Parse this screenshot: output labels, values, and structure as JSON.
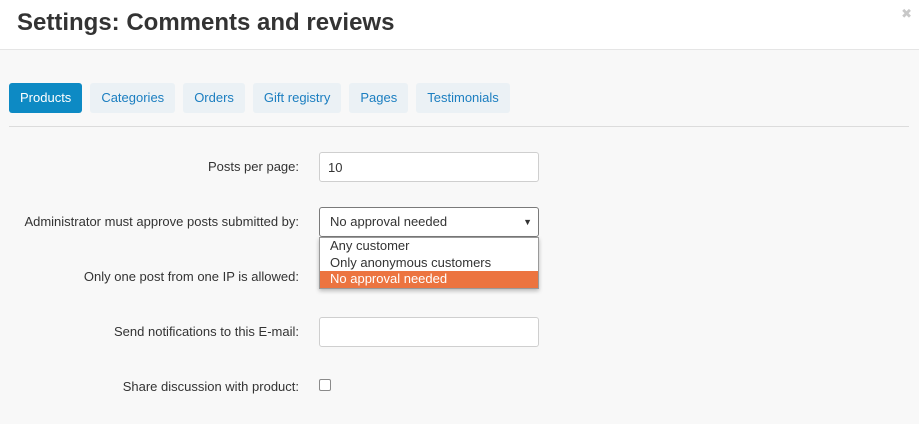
{
  "header": {
    "title": "Settings: Comments and reviews",
    "close_glyph": "✖",
    "close_icon": "close-icon"
  },
  "tabs": [
    {
      "label": "Products",
      "active": true
    },
    {
      "label": "Categories",
      "active": false
    },
    {
      "label": "Orders",
      "active": false
    },
    {
      "label": "Gift registry",
      "active": false
    },
    {
      "label": "Pages",
      "active": false
    },
    {
      "label": "Testimonials",
      "active": false
    }
  ],
  "form": {
    "posts_per_page": {
      "label": "Posts per page:",
      "value": "10"
    },
    "approve": {
      "label": "Administrator must approve posts submitted by:",
      "selected": "No approval needed",
      "options": [
        "Any customer",
        "Only anonymous customers",
        "No approval needed"
      ]
    },
    "one_post_ip": {
      "label": "Only one post from one IP is allowed:"
    },
    "notify_email": {
      "label": "Send notifications to this E-mail:",
      "value": ""
    },
    "share_discussion": {
      "label": "Share discussion with product:",
      "checked": false
    }
  },
  "colors": {
    "accent": "#0d8ac4",
    "tab_text": "#1b7ec0",
    "highlight": "#ec7440"
  }
}
